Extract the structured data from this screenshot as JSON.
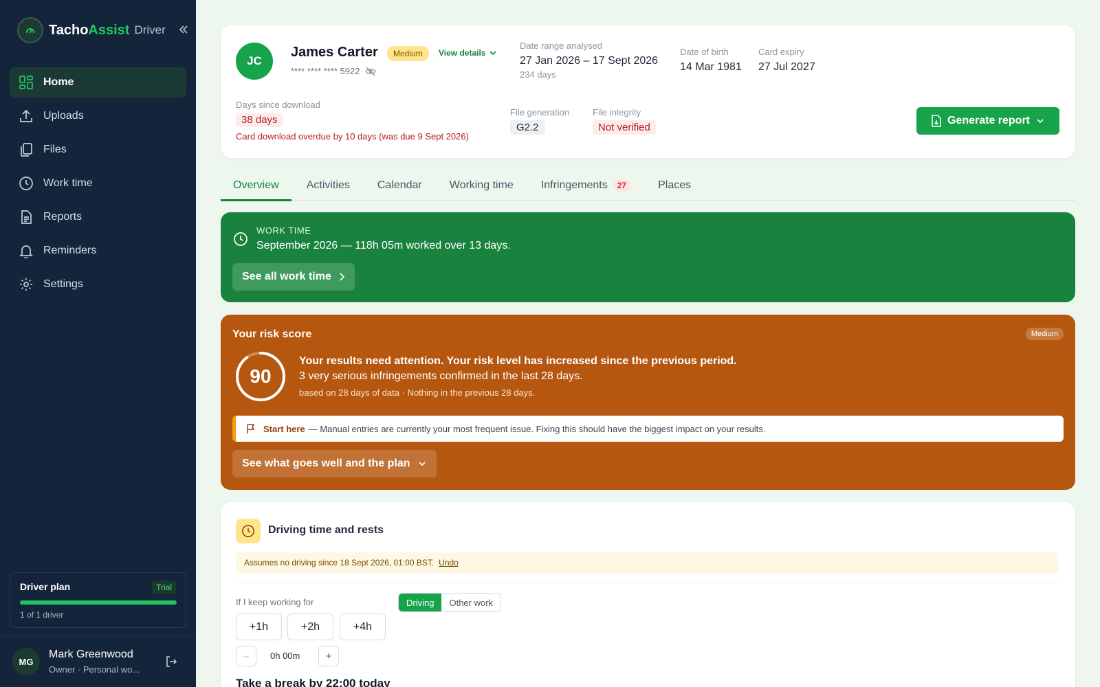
{
  "brand": {
    "name_part1": "Tacho",
    "name_part2": "Assist",
    "sub": "Driver"
  },
  "nav": [
    {
      "label": "Home",
      "icon": "grid-icon",
      "active": true
    },
    {
      "label": "Uploads",
      "icon": "upload-icon"
    },
    {
      "label": "Files",
      "icon": "files-icon"
    },
    {
      "label": "Work time",
      "icon": "clock-icon"
    },
    {
      "label": "Reports",
      "icon": "report-icon"
    },
    {
      "label": "Reminders",
      "icon": "bell-icon"
    },
    {
      "label": "Settings",
      "icon": "gear-icon"
    }
  ],
  "plan": {
    "title": "Driver plan",
    "badge": "Trial",
    "count": "1 of 1 driver",
    "progress": 1.0
  },
  "user": {
    "initials": "MG",
    "name": "Mark Greenwood",
    "role": "Owner · Personal wo..."
  },
  "profile": {
    "initials": "JC",
    "name": "James Carter",
    "risk_badge": "Medium",
    "view_details": "View details",
    "card_number": "**** **** **** 5922",
    "date_range_label": "Date range analysed",
    "date_range": "27 Jan 2026 – 17 Sept 2026",
    "date_range_days": "234 days",
    "dob_label": "Date of birth",
    "dob": "14 Mar 1981",
    "expiry_label": "Card expiry",
    "expiry": "27 Jul 2027",
    "download_label": "Days since download",
    "download_days": "38 days",
    "overdue": "Card download overdue by 10 days (was due 9 Sept 2026)",
    "generation_label": "File generation",
    "generation": "G2.2",
    "integrity_label": "File integrity",
    "integrity": "Not verified",
    "generate_report": "Generate report"
  },
  "tabs": [
    {
      "label": "Overview",
      "active": true
    },
    {
      "label": "Activities"
    },
    {
      "label": "Calendar"
    },
    {
      "label": "Working time"
    },
    {
      "label": "Infringements",
      "count": "27"
    },
    {
      "label": "Places"
    }
  ],
  "work": {
    "kicker": "WORK TIME",
    "text": "September 2026 — 118h 05m worked over 13 days.",
    "button": "See all work time"
  },
  "risk": {
    "title": "Your risk score",
    "badge": "Medium",
    "score": "90",
    "score_fraction": 0.9,
    "headline": "Your results need attention. Your risk level has increased since the previous period.",
    "detail": "3 very serious infringements confirmed in the last 28 days.",
    "basis": "based on 28 days of data · Nothing in the previous 28 days.",
    "tip_lead": "Start here",
    "tip_text": "— Manual entries are currently your most frequent issue. Fixing this should have the biggest impact on your results.",
    "button": "See what goes well and the plan"
  },
  "driving": {
    "title": "Driving time and rests",
    "assume": "Assumes no driving since 18 Sept 2026, 01:00 BST.",
    "undo": "Undo",
    "keep_label": "If I keep working for",
    "mode_driving": "Driving",
    "mode_other": "Other work",
    "inc1": "+1h",
    "inc2": "+2h",
    "inc3": "+4h",
    "minus": "–",
    "plus": "+",
    "stepper_value": "0h 00m",
    "advice": "Take a break by 22:00 today"
  },
  "colors": {
    "brand_green": "#16a34a",
    "sidebar": "#14243b",
    "risk_orange": "#b5570f",
    "work_green": "#19823f"
  }
}
